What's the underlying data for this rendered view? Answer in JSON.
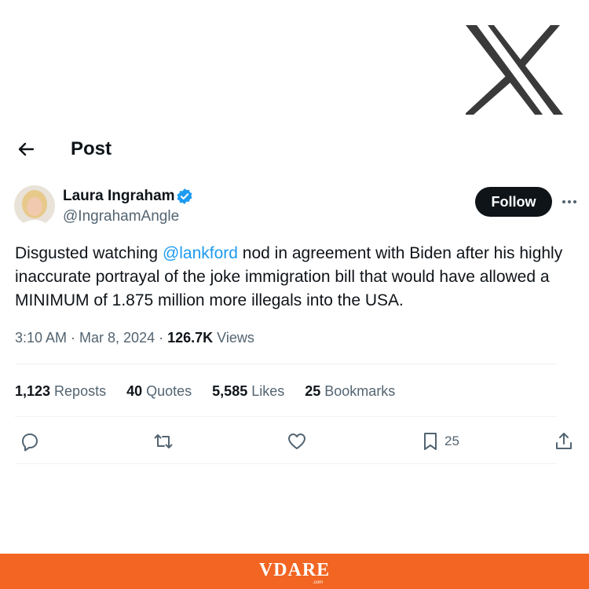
{
  "brand_colors": {
    "x_logo": "#3a3a3a",
    "link": "#1d9bf0",
    "footer": "#f26522",
    "follow_bg": "#0f1419",
    "verified": "#1d9bf0"
  },
  "header": {
    "title": "Post",
    "back_icon": "arrow-left-icon"
  },
  "author": {
    "name": "Laura Ingraham",
    "handle": "@IngrahamAngle",
    "verified_icon": "verified-badge-icon",
    "follow_label": "Follow",
    "more_icon": "more-horizontal-icon"
  },
  "tweet": {
    "text_before": "Disgusted watching ",
    "mention": "@lankford",
    "text_after": " nod in agreement with Biden after  his highly inaccurate portrayal of the joke immigration bill that would have allowed a MINIMUM of 1.875 million more illegals into the USA."
  },
  "meta": {
    "timestamp": "3:10 AM · Mar 8, 2024 · ",
    "views_count": "126.7K",
    "views_label": " Views"
  },
  "stats": {
    "reposts": {
      "count": "1,123",
      "label": " Reposts"
    },
    "quotes": {
      "count": "40",
      "label": " Quotes"
    },
    "likes": {
      "count": "5,585",
      "label": " Likes"
    },
    "bookmarks": {
      "count": "25",
      "label": " Bookmarks"
    }
  },
  "actions": {
    "reply_icon": "reply-icon",
    "repost_icon": "repost-icon",
    "like_icon": "heart-icon",
    "bookmark_icon": "bookmark-icon",
    "bookmark_count": "25",
    "share_icon": "share-icon"
  },
  "footer": {
    "brand": "VDARE",
    "sub": ".com"
  }
}
